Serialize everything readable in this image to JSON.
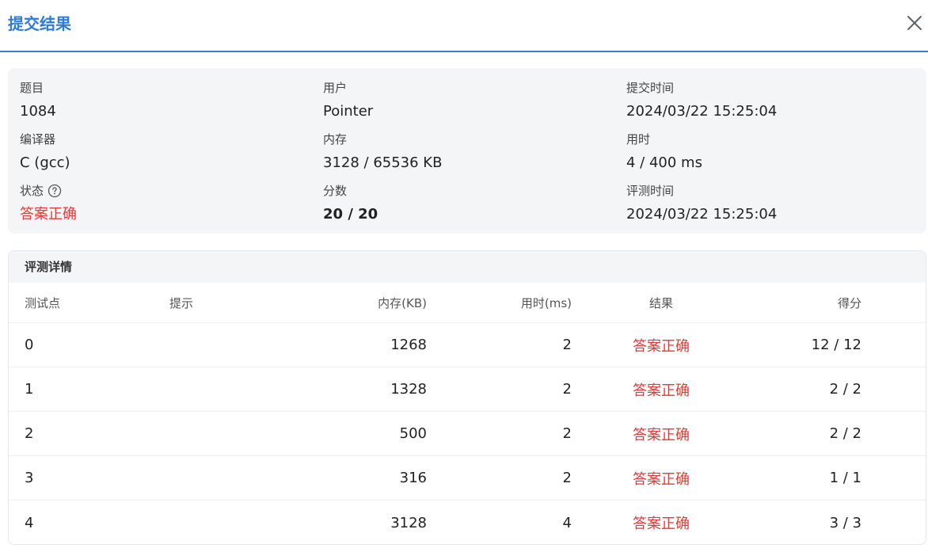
{
  "dialog": {
    "title": "提交结果",
    "close_icon": "close-icon"
  },
  "info": {
    "problem_label": "题目",
    "problem_value": "1084",
    "user_label": "用户",
    "user_value": "Pointer",
    "submit_time_label": "提交时间",
    "submit_time_value": "2024/03/22 15:25:04",
    "compiler_label": "编译器",
    "compiler_value": "C (gcc)",
    "memory_label": "内存",
    "memory_value": "3128 / 65536 KB",
    "time_label": "用时",
    "time_value": "4 / 400 ms",
    "status_label": "状态",
    "status_value": "答案正确",
    "score_label": "分数",
    "score_value": "20 / 20",
    "judge_time_label": "评测时间",
    "judge_time_value": "2024/03/22 15:25:04"
  },
  "details": {
    "title": "评测详情",
    "columns": {
      "point": "测试点",
      "hint": "提示",
      "memory": "内存(KB)",
      "time": "用时(ms)",
      "result": "结果",
      "score": "得分"
    },
    "rows": [
      {
        "point": "0",
        "hint": "",
        "memory": "1268",
        "time": "2",
        "result": "答案正确",
        "score": "12 / 12"
      },
      {
        "point": "1",
        "hint": "",
        "memory": "1328",
        "time": "2",
        "result": "答案正确",
        "score": "2 / 2"
      },
      {
        "point": "2",
        "hint": "",
        "memory": "500",
        "time": "2",
        "result": "答案正确",
        "score": "2 / 2"
      },
      {
        "point": "3",
        "hint": "",
        "memory": "316",
        "time": "2",
        "result": "答案正确",
        "score": "1 / 1"
      },
      {
        "point": "4",
        "hint": "",
        "memory": "3128",
        "time": "4",
        "result": "答案正确",
        "score": "3 / 3"
      }
    ]
  },
  "colors": {
    "accent": "#2f7bd9",
    "success_text": "#e53935",
    "card_background": "#f4f5f7"
  }
}
